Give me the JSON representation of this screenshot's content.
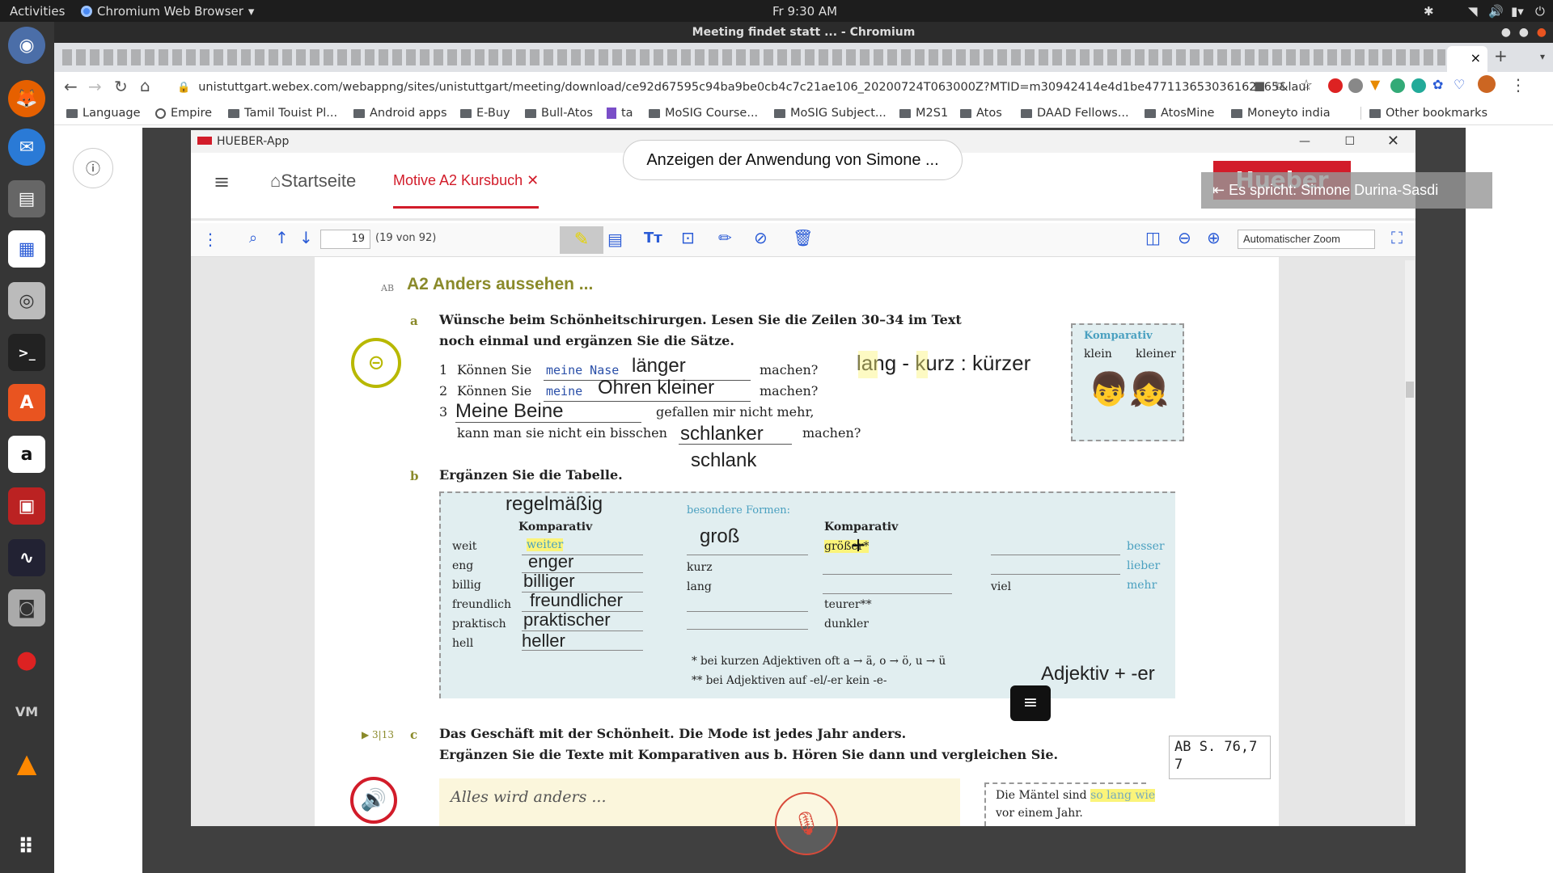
{
  "system": {
    "activities": "Activities",
    "app_name": "Chromium Web Browser",
    "clock": "Fr  9:30 AM"
  },
  "window": {
    "title": "Meeting findet statt ... - Chromium"
  },
  "browser": {
    "url": "unistuttgart.webex.com/webappng/sites/unistuttgart/meeting/download/ce92d67595c94ba9be0cb4c7c21ae106_20200724T063000Z?MTID=m30942414e4d1be477113653036162165&launchApp...",
    "new_tab": "+",
    "close_tab": "×"
  },
  "bookmarks": {
    "items": [
      "Language",
      "Empire",
      "Tamil Touist Pl...",
      "Android apps",
      "E-Buy",
      "Bull-Atos",
      "ta",
      "MoSIG Course...",
      "MoSIG Subject...",
      "M2S1",
      "Atos",
      "DAAD Fellows...",
      "AtosMine",
      "Moneyto india"
    ],
    "other": "Other bookmarks"
  },
  "meeting": {
    "sharing_banner": "Anzeigen der Anwendung von Simone ...",
    "speaker": "Es spricht: Simone Durina-Sasdi"
  },
  "app": {
    "title": "HUEBER-App",
    "home": "Startseite",
    "tab": "Motive A2 Kursbuch",
    "brand": "Hueber"
  },
  "viewer": {
    "page_input": "19",
    "page_total": "(19 von 92)",
    "zoom": "Automatischer Zoom"
  },
  "exercise": {
    "tag": "AB",
    "heading": "A2 Anders aussehen ...",
    "a_letter": "a",
    "a_text1": "Wünsche beim Schönheitschirurgen. Lesen Sie die Zeilen 30–34 im Text",
    "a_text2": "noch einmal und ergänzen Sie die Sätze.",
    "s1_num": "1",
    "s1_pre": "Können Sie",
    "s1_fill": "meine Nase",
    "s1_hand": "länger",
    "s1_post": "machen?",
    "s2_num": "2",
    "s2_pre": "Können Sie",
    "s2_fill": "meine",
    "s2_hand": "Ohren kleiner",
    "s2_post": "machen?",
    "s3_num": "3",
    "s3_hand": "Meine Beine",
    "s3_post": "gefallen mir nicht mehr,",
    "s4_pre": "kann man sie nicht ein bisschen",
    "s4_hand": "schlanker",
    "s4_post": "machen?",
    "note_hand": "lang - kurz : kürzer",
    "note_hand2": "schlank",
    "komp_title": "Komparativ",
    "komp_left": "klein",
    "komp_right": "kleiner",
    "b_letter": "b",
    "b_text": "Ergänzen Sie die Tabelle.",
    "regel_hand": "regelmäßig",
    "besondere": "besondere Formen:",
    "komparativ_col1": "Komparativ",
    "komparativ_col2": "Komparativ",
    "gross_hand": "groß",
    "rows": [
      {
        "adj": "weit",
        "comp": "weiter"
      },
      {
        "adj": "eng",
        "comp": "enger"
      },
      {
        "adj": "billig",
        "comp": "billiger"
      },
      {
        "adj": "freundlich",
        "comp": "freundlicher"
      },
      {
        "adj": "praktisch",
        "comp": "praktischer"
      },
      {
        "adj": "hell",
        "comp": "heller"
      }
    ],
    "mid_kurz": "kurz",
    "mid_lang": "lang",
    "mid_grosser": "größer*",
    "mid_teurer": "teurer**",
    "mid_dunkler": "dunkler",
    "right_viel": "viel",
    "right_besser": "besser",
    "right_lieber": "lieber",
    "right_mehr": "mehr",
    "foot1": "*   bei kurzen Adjektiven oft a → ä, o → ö, u → ü",
    "foot2": "** bei Adjektiven auf -el/-er kein -e-",
    "adj_er_hand": "Adjektiv + -er",
    "c_track": "▶ 3|13",
    "c_letter": "c",
    "c_text1": "Das Geschäft mit der Schönheit. Die Mode ist jedes Jahr anders.",
    "c_text2": "Ergänzen Sie die Texte mit Komparativen aus b. Hören Sie dann und vergleichen Sie.",
    "alles": "Alles wird anders ...",
    "ab_ref": "AB S. 76,77",
    "maentel1": "Die Mäntel sind",
    "maentel_hl": "so lang wie",
    "maentel2": "vor einem Jahr."
  }
}
